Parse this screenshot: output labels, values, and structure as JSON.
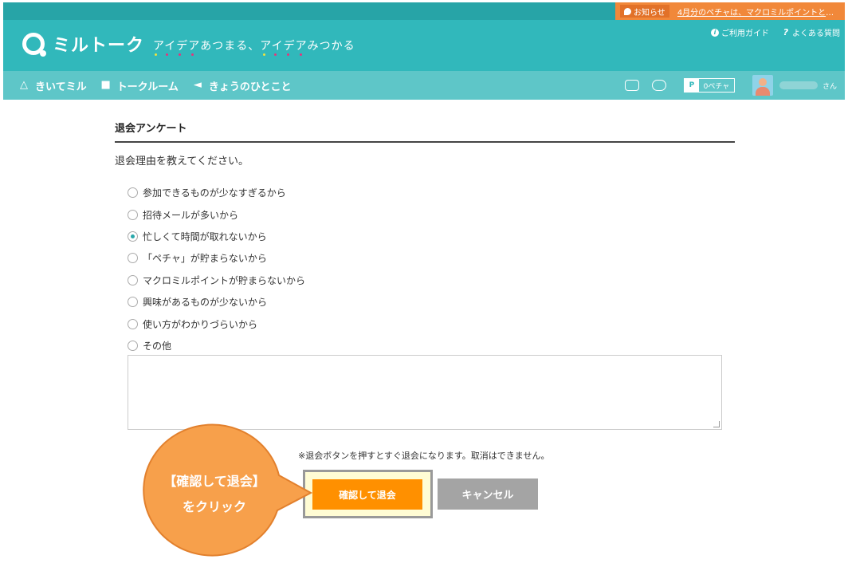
{
  "topbar": {
    "notice_label": "お知らせ",
    "notice_text": "4月分のペチャは、マクロミルポイントとし…"
  },
  "brand": {
    "logo": "ミルトーク",
    "tagline": "アイデアあつまる、アイデアみつかる",
    "tagline_dot_colors": [
      "#f2e33a",
      "#e8327b",
      "#e8327b",
      "#e8327b",
      "#f2e33a",
      "#e8327b",
      "#e8327b",
      "#e8327b"
    ]
  },
  "help": {
    "guide_label": "ご利用ガイド",
    "faq_label": "よくある質問"
  },
  "nav": {
    "items": [
      {
        "label": "きいてミル",
        "icon": "mortarboard-icon"
      },
      {
        "label": "トークルーム",
        "icon": "chat-icon"
      },
      {
        "label": "きょうのひとこと",
        "icon": "megaphone-icon"
      }
    ],
    "point_prefix": "P",
    "point_value": "0ペチャ",
    "user_suffix": "さん"
  },
  "survey": {
    "title": "退会アンケート",
    "question": "退会理由を教えてください。",
    "options": [
      "参加できるものが少なすぎるから",
      "招待メールが多いから",
      "忙しくて時間が取れないから",
      "「ペチャ」が貯まらないから",
      "マクロミルポイントが貯まらないから",
      "興味があるものが少ないから",
      "使い方がわかりづらいから",
      "その他"
    ],
    "selected_index": 2,
    "other_value": "",
    "warning": "※退会ボタンを押すとすぐ退会になります。取消はできません。",
    "confirm_label": "確認して退会",
    "cancel_label": "キャンセル"
  },
  "callout": {
    "line1": "【確認して退会】",
    "line2": "をクリック",
    "color": "#f7a04b",
    "border_color": "#e2802d"
  }
}
